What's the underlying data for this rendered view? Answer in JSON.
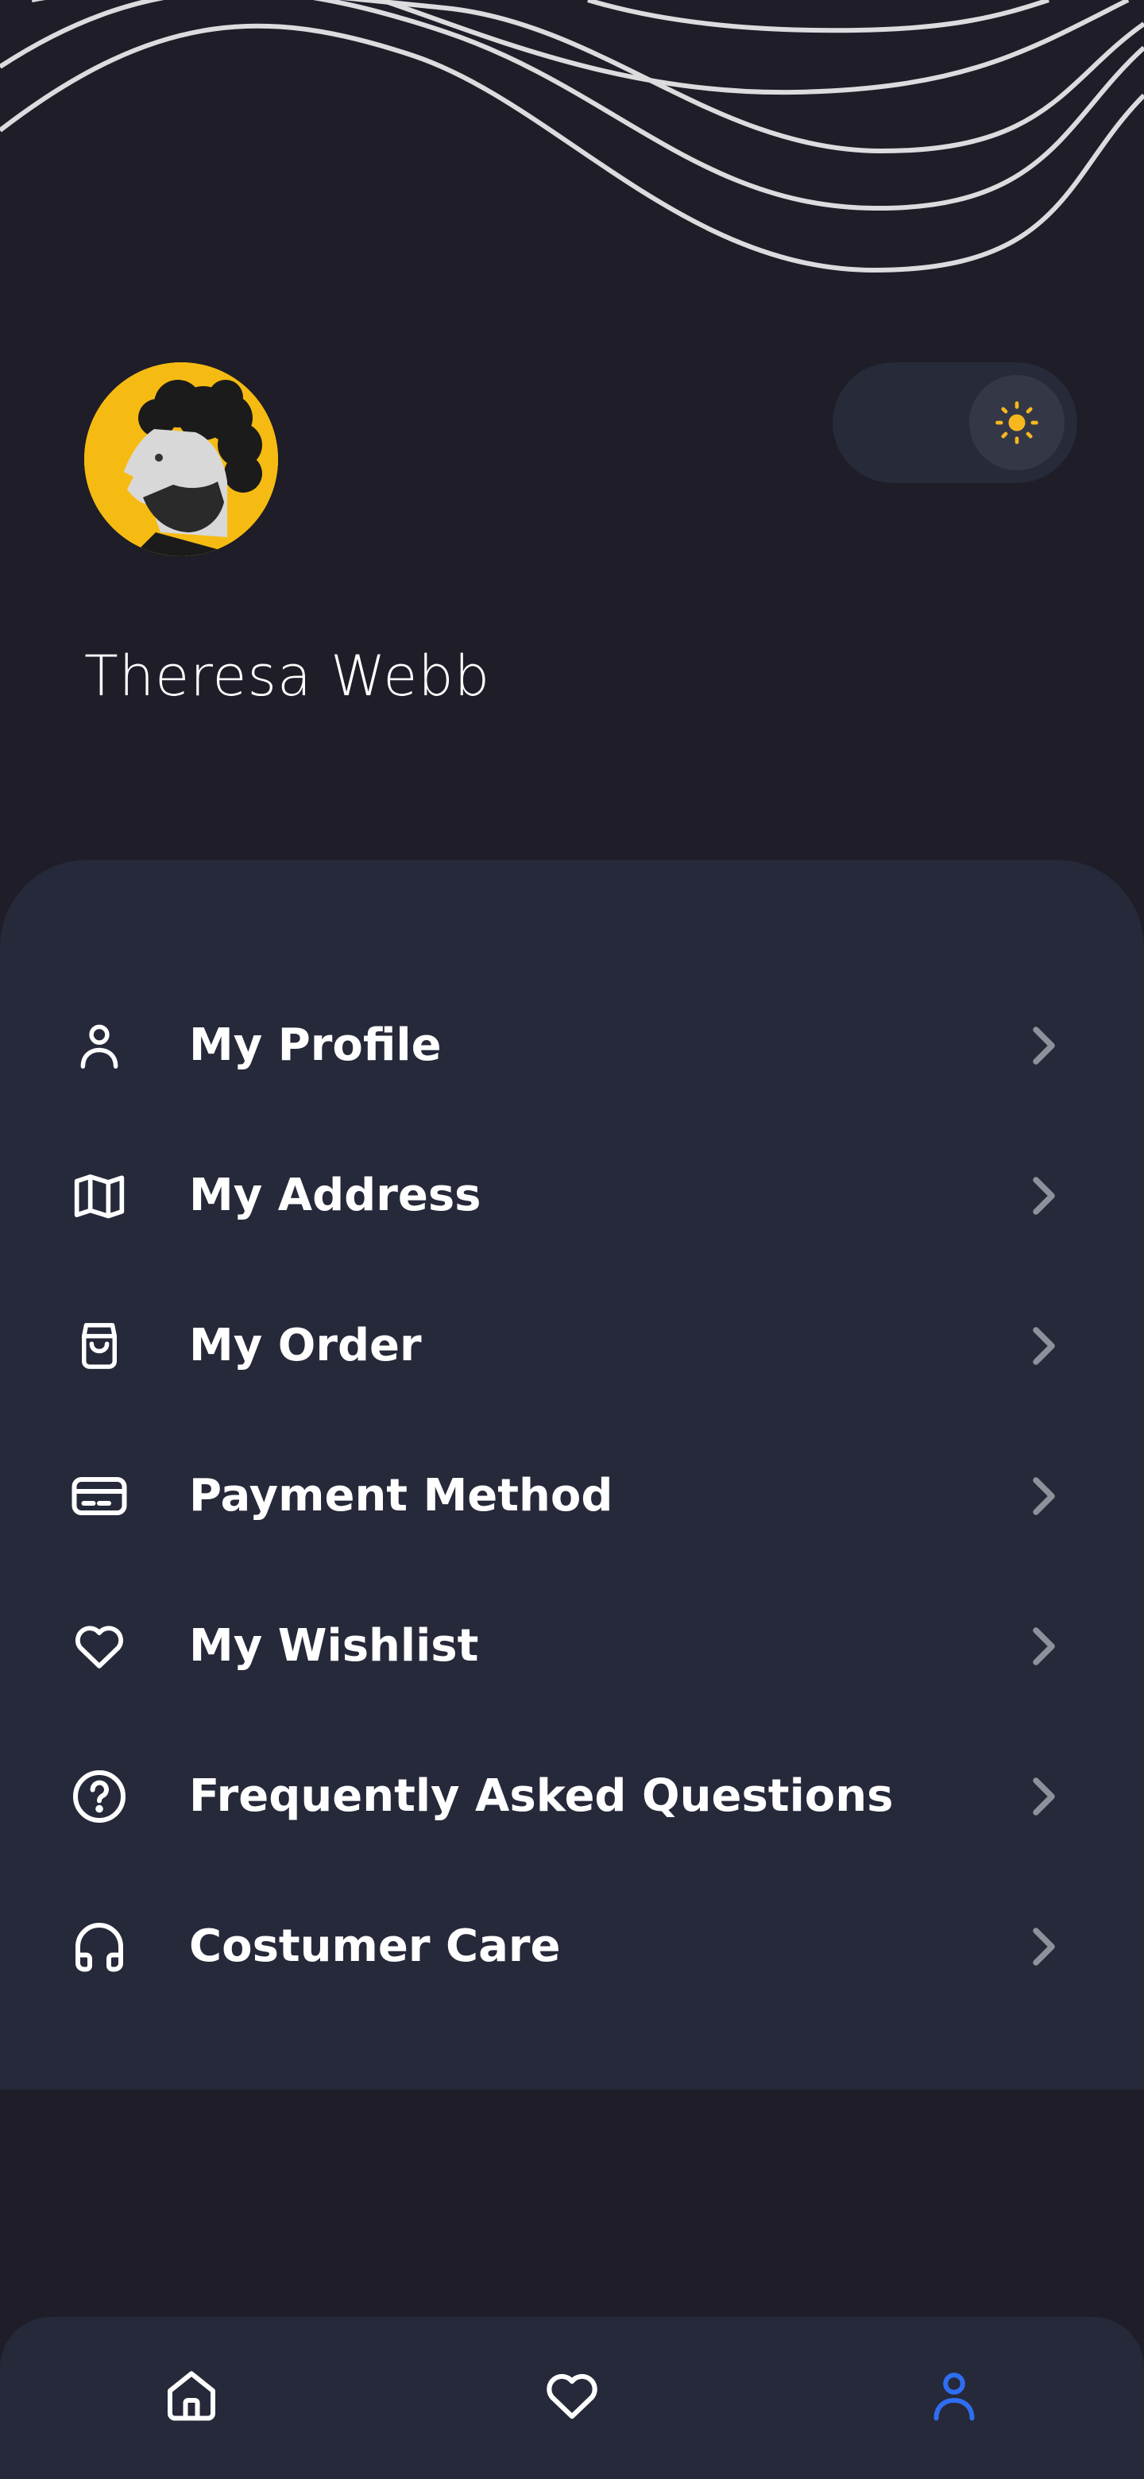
{
  "colors": {
    "background": "#1e1d28",
    "panel": "#252939",
    "text": "#ffffff",
    "chevron": "#8e919c",
    "accent": "#2f6df2",
    "sun": "#f6b81e",
    "avatar_bg": "#f6bb12"
  },
  "profile": {
    "name": "Theresa Webb"
  },
  "theme_toggle": {
    "icon": "sun-icon",
    "state": "light"
  },
  "menu": {
    "items": [
      {
        "label": "My Profile",
        "icon": "user-icon"
      },
      {
        "label": "My Address",
        "icon": "map-icon"
      },
      {
        "label": "My Order",
        "icon": "shopping-bag-icon"
      },
      {
        "label": "Payment Method",
        "icon": "credit-card-icon"
      },
      {
        "label": "My Wishlist",
        "icon": "heart-icon"
      },
      {
        "label": "Frequently Asked Questions",
        "icon": "help-circle-icon"
      },
      {
        "label": "Costumer Care",
        "icon": "headphones-icon"
      }
    ]
  },
  "bottom_nav": {
    "items": [
      {
        "icon": "home-icon",
        "active": false
      },
      {
        "icon": "heart-icon",
        "active": false
      },
      {
        "icon": "user-icon",
        "active": true
      }
    ]
  }
}
